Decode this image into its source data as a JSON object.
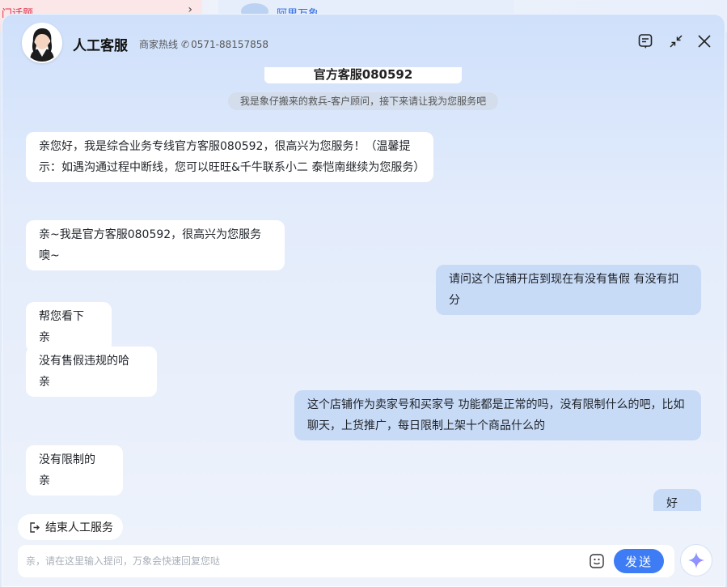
{
  "background": {
    "left_tab_text": "门话题",
    "right_tab_text": "阿里万象"
  },
  "header": {
    "agent_name": "人工客服",
    "hotline_label": "商家热线",
    "hotline_number": "0571-88157858",
    "history_icon": "chat-history-icon",
    "shrink_icon": "shrink-icon",
    "close_icon": "close-icon"
  },
  "chat": {
    "top_card_text": "官方客服080592",
    "system_note": "我是象仔搬来的救兵-客户顾问，接下来请让我为您服务吧",
    "messages": [
      {
        "role": "agent",
        "text": "亲您好，我是综合业务专线官方客服080592，很高兴为您服务！（温馨提示：如遇沟通过程中断线，您可以旺旺&千牛联系小二 泰恺南继续为您服务）"
      },
      {
        "role": "agent",
        "text": "亲~我是官方客服080592，很高兴为您服务噢~"
      },
      {
        "role": "user",
        "text": "请问这个店铺开店到现在有没有售假 有没有扣分"
      },
      {
        "role": "agent",
        "text": "帮您看下 亲"
      },
      {
        "role": "agent",
        "text": "没有售假违规的哈 亲"
      },
      {
        "role": "user",
        "text": "这个店铺作为卖家号和买家号 功能都是正常的吗，没有限制什么的吧，比如聊天，上货推广，每日限制上架十个商品什么的"
      },
      {
        "role": "agent",
        "text": "没有限制的 亲"
      },
      {
        "role": "user",
        "text": "好的"
      }
    ]
  },
  "footer": {
    "end_service_label": "结束人工服务",
    "input_placeholder": "亲，请在这里输入提问，万象会快速回复您哒",
    "input_value": "",
    "send_label": "发送"
  },
  "colors": {
    "accent": "#3d7cf4",
    "user_bubble": "#c7daf6",
    "agent_bubble": "#ffffff"
  }
}
